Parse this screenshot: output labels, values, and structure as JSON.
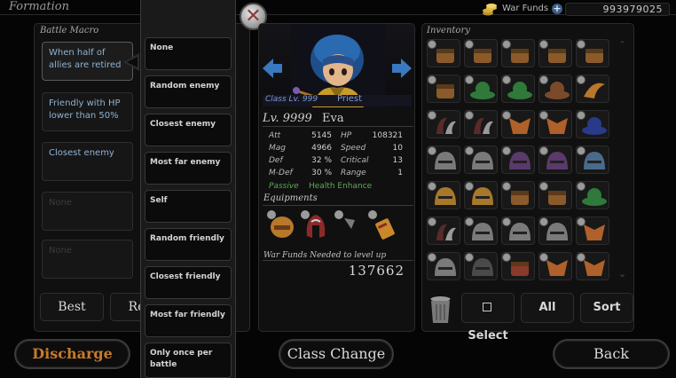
{
  "header": {
    "title": "Formation",
    "war_funds_label": "War Funds",
    "war_funds_value": "993979025",
    "plus_symbol": "+"
  },
  "macro": {
    "title": "Battle Macro",
    "slots": [
      {
        "text": "When half of allies are retired",
        "active": true
      },
      {
        "text": "Friendly with HP lower than 50%",
        "active": false
      },
      {
        "text": "Closest enemy",
        "active": false
      },
      {
        "text": "None",
        "active": false
      },
      {
        "text": "None",
        "active": false
      }
    ],
    "best_label": "Best",
    "reset_label": "Re"
  },
  "dropdown": {
    "options": [
      "None",
      "Random enemy",
      "Closest enemy",
      "Most far enemy",
      "Self",
      "Random friendly",
      "Closest friendly",
      "Most far friendly",
      "Only once per battle"
    ]
  },
  "close_symbol": "✕",
  "character": {
    "class_level": "Class Lv. 999",
    "class_name": "Priest",
    "level": "Lv. 9999",
    "name": "Eva",
    "stats_left": [
      {
        "label": "Att",
        "value": "5145"
      },
      {
        "label": "Mag",
        "value": "4966"
      },
      {
        "label": "Def",
        "value": "32 %"
      },
      {
        "label": "M-Def",
        "value": "30 %"
      }
    ],
    "stats_right": [
      {
        "label": "HP",
        "value": "108321"
      },
      {
        "label": "Speed",
        "value": "10"
      },
      {
        "label": "Critical",
        "value": "13"
      },
      {
        "label": "Range",
        "value": "1"
      }
    ],
    "passive_label": "Passive",
    "passive_value": "Health Enhance",
    "equipments_title": "Equipments",
    "level_up_label": "War Funds Needed to level up",
    "level_up_value": "137662",
    "arrow_left": "◀",
    "arrow_right": "▶"
  },
  "inventory": {
    "title": "Inventory",
    "select_label": "Select",
    "all_label": "All",
    "sort_label": "Sort",
    "scroll_up": "⌃",
    "scroll_down": "⌄",
    "items": [
      [
        "chest-brown",
        "chest-brown",
        "chest-brown",
        "chest-brown",
        "chest-brown"
      ],
      [
        "chest-brown",
        "hat-green",
        "hat-green",
        "hat-feather",
        "horn-orange"
      ],
      [
        "claw-dark",
        "claw-dark",
        "mask-orange",
        "mask-orange",
        "hat-blue"
      ],
      [
        "helm-iron",
        "helm-iron",
        "helm-purple",
        "helm-purple",
        "helm-spike"
      ],
      [
        "helm-gold",
        "helm-gold",
        "chest-brown",
        "chest-brown",
        "hat-green"
      ],
      [
        "claw-dark",
        "helm-iron",
        "helm-iron",
        "helm-iron",
        "mask-orange"
      ],
      [
        "helm-iron",
        "helm-dark",
        "chest-red",
        "mask-orange",
        "mask-orange"
      ]
    ],
    "colors": {
      "chest-brown": "#8a5a2a",
      "hat-green": "#2f7a3a",
      "hat-feather": "#7a4a2a",
      "horn-orange": "#b8772a",
      "claw-dark": "#5a2a2a",
      "mask-orange": "#b0602a",
      "hat-blue": "#2a3a8a",
      "helm-iron": "#7a7a7a",
      "helm-purple": "#5a3a6a",
      "helm-spike": "#4a6a8a",
      "helm-gold": "#a8782a",
      "helm-dark": "#4a4a4a",
      "chest-red": "#8a3a2a"
    }
  },
  "bottom": {
    "discharge_label": "Discharge",
    "class_change_label": "Class Change",
    "back_label": "Back"
  }
}
